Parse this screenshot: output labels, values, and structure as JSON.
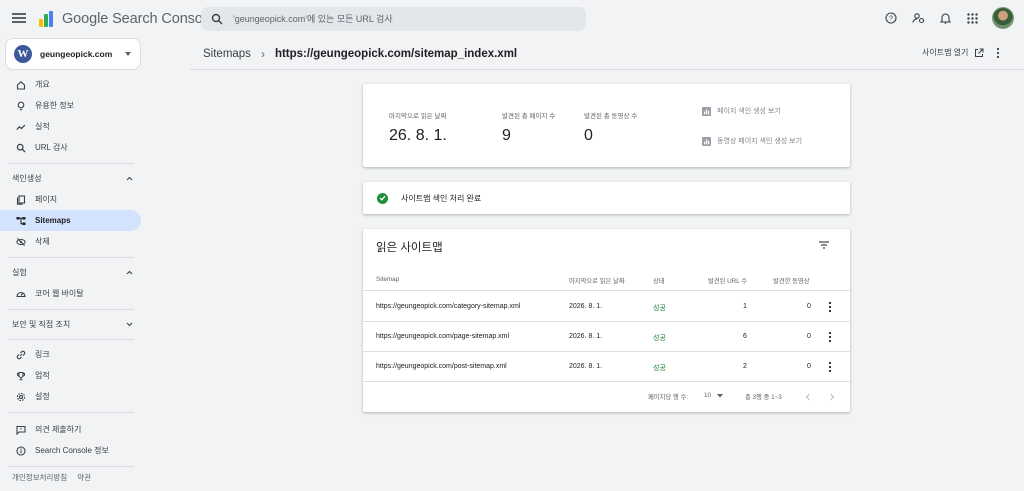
{
  "app": {
    "title": "Google Search Console"
  },
  "search": {
    "placeholder": "'geungeopick.com'에 있는 모든 URL 검사"
  },
  "property": {
    "name": "geungeopick.com"
  },
  "sidebar": {
    "top_items": [
      {
        "label": "개요",
        "icon": "home-icon"
      },
      {
        "label": "유용한 정보",
        "icon": "lightbulb-icon"
      },
      {
        "label": "실적",
        "icon": "trending-icon"
      },
      {
        "label": "URL 검사",
        "icon": "search-icon"
      }
    ],
    "indexing": {
      "title": "색인생성",
      "items": [
        {
          "label": "페이지",
          "icon": "pages-icon"
        },
        {
          "label": "Sitemaps",
          "icon": "sitemap-icon"
        },
        {
          "label": "삭제",
          "icon": "removal-icon"
        }
      ]
    },
    "experience": {
      "title": "실험",
      "items": [
        {
          "label": "코어 웹 바이탈",
          "icon": "gauge-icon"
        }
      ]
    },
    "security": {
      "title": "보안 및 직접 조치"
    },
    "more_items": [
      {
        "label": "링크",
        "icon": "link-icon"
      },
      {
        "label": "업적",
        "icon": "trophy-icon"
      },
      {
        "label": "설정",
        "icon": "settings-icon"
      }
    ],
    "bottom_items": [
      {
        "label": "의견 제출하기",
        "icon": "feedback-icon"
      },
      {
        "label": "Search Console 정보",
        "icon": "info-icon"
      }
    ],
    "footer": {
      "privacy": "개인정보처리방침",
      "terms": "약관"
    }
  },
  "breadcrumb": {
    "root": "Sitemaps",
    "current": "https://geungeopick.com/sitemap_index.xml"
  },
  "header": {
    "open_sitemap": "사이트맵 열기"
  },
  "summary": {
    "last_read_label": "마지막으로 읽은 날짜",
    "last_read_value": "26. 8. 1.",
    "pages_label": "발견된 총 페이지 수",
    "pages_value": "9",
    "videos_label": "발견된 총 동영상 수",
    "videos_value": "0",
    "page_index_link": "페이지 색인 생성 보기",
    "video_index_link": "동영상 페이지 색인 생성 보기"
  },
  "status": {
    "text": "사이트맵 색인 처리 완료"
  },
  "table": {
    "title": "읽은 사이트맵",
    "headers": {
      "sitemap": "Sitemap",
      "last_read": "마지막으로 읽은 날짜",
      "status": "상태",
      "urls": "발견된 URL 수",
      "videos": "발견한 동영상"
    },
    "rows": [
      {
        "sitemap": "https://geungeopick.com/category-sitemap.xml",
        "last_read": "2026. 8. 1.",
        "status": "성공",
        "urls": "1",
        "videos": "0"
      },
      {
        "sitemap": "https://geungeopick.com/page-sitemap.xml",
        "last_read": "2026. 8. 1.",
        "status": "성공",
        "urls": "6",
        "videos": "0"
      },
      {
        "sitemap": "https://geungeopick.com/post-sitemap.xml",
        "last_read": "2026. 8. 1.",
        "status": "성공",
        "urls": "2",
        "videos": "0"
      }
    ],
    "pagination": {
      "rows_per_page_label": "페이지당 행 수:",
      "rows_per_page": "10",
      "range": "총 3행 중 1~3"
    }
  },
  "colors": {
    "accent": "#d3e3fd",
    "success": "#188038",
    "check": "#1e8e3e"
  }
}
